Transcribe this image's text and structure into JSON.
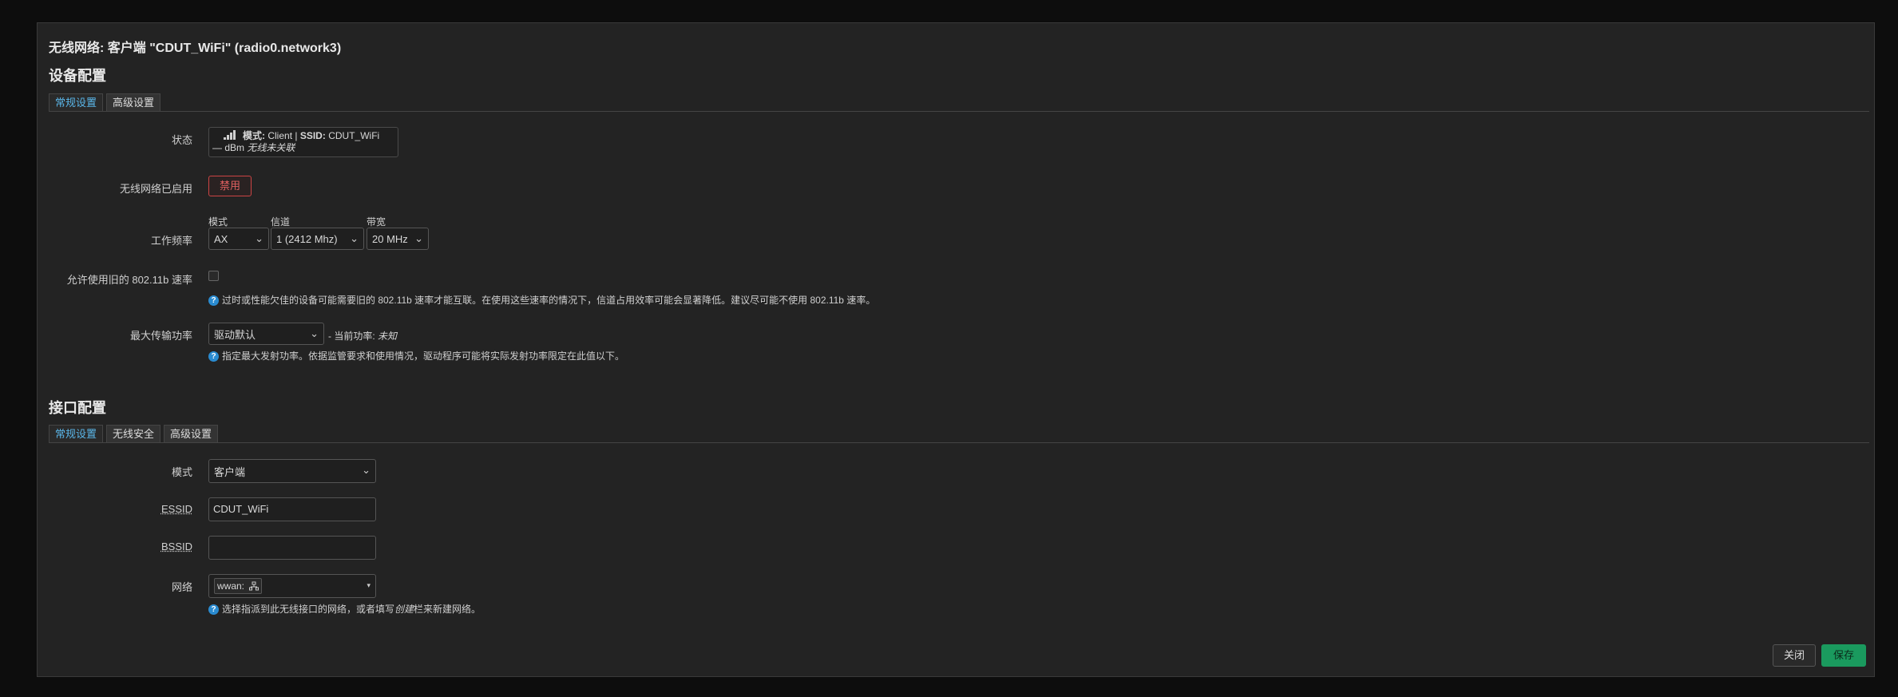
{
  "dialog_title": "无线网络: 客户端 \"CDUT_WiFi\" (radio0.network3)",
  "device_section": {
    "title": "设备配置",
    "tabs": [
      {
        "label": "常规设置",
        "active": true
      },
      {
        "label": "高级设置",
        "active": false
      }
    ],
    "status": {
      "label": "状态",
      "mode_key": "模式:",
      "mode_value": "Client",
      "separator": "|",
      "ssid_key": "SSID:",
      "ssid_value": "CDUT_WiFi",
      "dbm": "— dBm",
      "assoc": "无线未关联",
      "icon": "signal-icon"
    },
    "enabled": {
      "label": "无线网络已启用",
      "button": "禁用"
    },
    "frequency": {
      "label": "工作频率",
      "mode_label": "模式",
      "mode_value": "AX",
      "channel_label": "信道",
      "channel_value": "1 (2412 Mhz)",
      "width_label": "带宽",
      "width_value": "20 MHz"
    },
    "legacy_rates": {
      "label": "允许使用旧的 802.11b 速率",
      "checked": false,
      "help": "过时或性能欠佳的设备可能需要旧的 802.11b 速率才能互联。在使用这些速率的情况下，信道占用效率可能会显著降低。建议尽可能不使用 802.11b 速率。"
    },
    "tx_power": {
      "label": "最大传输功率",
      "value": "驱动默认",
      "current_prefix": "- 当前功率:",
      "current_value": "未知",
      "help": "指定最大发射功率。依据监管要求和使用情况，驱动程序可能将实际发射功率限定在此值以下。"
    }
  },
  "interface_section": {
    "title": "接口配置",
    "tabs": [
      {
        "label": "常规设置",
        "active": true
      },
      {
        "label": "无线安全",
        "active": false
      },
      {
        "label": "高级设置",
        "active": false
      }
    ],
    "mode": {
      "label": "模式",
      "value": "客户端"
    },
    "essid": {
      "label": "ESSID",
      "value": "CDUT_WiFi"
    },
    "bssid": {
      "label": "BSSID",
      "value": ""
    },
    "network": {
      "label": "网络",
      "tag": "wwan:",
      "tag_icon": "network-icon",
      "help_pre": "选择指派到此无线接口的网络，或者填写",
      "help_em": "创建",
      "help_post": "栏来新建网络。"
    }
  },
  "footer": {
    "close": "关闭",
    "save": "保存"
  },
  "colors": {
    "accent": "#5bb7ea",
    "danger": "#e06060",
    "save": "#1a9a5e"
  }
}
